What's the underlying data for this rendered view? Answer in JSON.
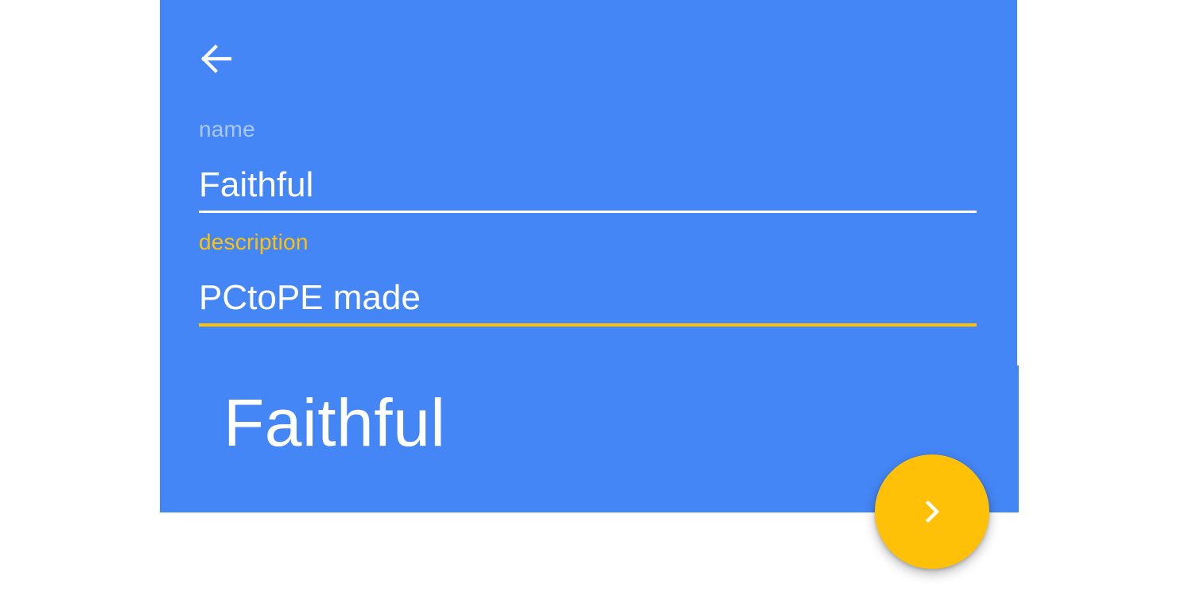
{
  "colors": {
    "primary": "#4486F5",
    "accent": "#FFC107",
    "on_primary": "#FFFFFF"
  },
  "toolbar": {
    "back_icon": "arrow-left-icon"
  },
  "form": {
    "name": {
      "label": "name",
      "value": "Faithful"
    },
    "description": {
      "label": "description",
      "value": "PCtoPE made"
    }
  },
  "preview": {
    "title": "Faithful"
  },
  "fab": {
    "icon": "chevron-right-icon"
  }
}
